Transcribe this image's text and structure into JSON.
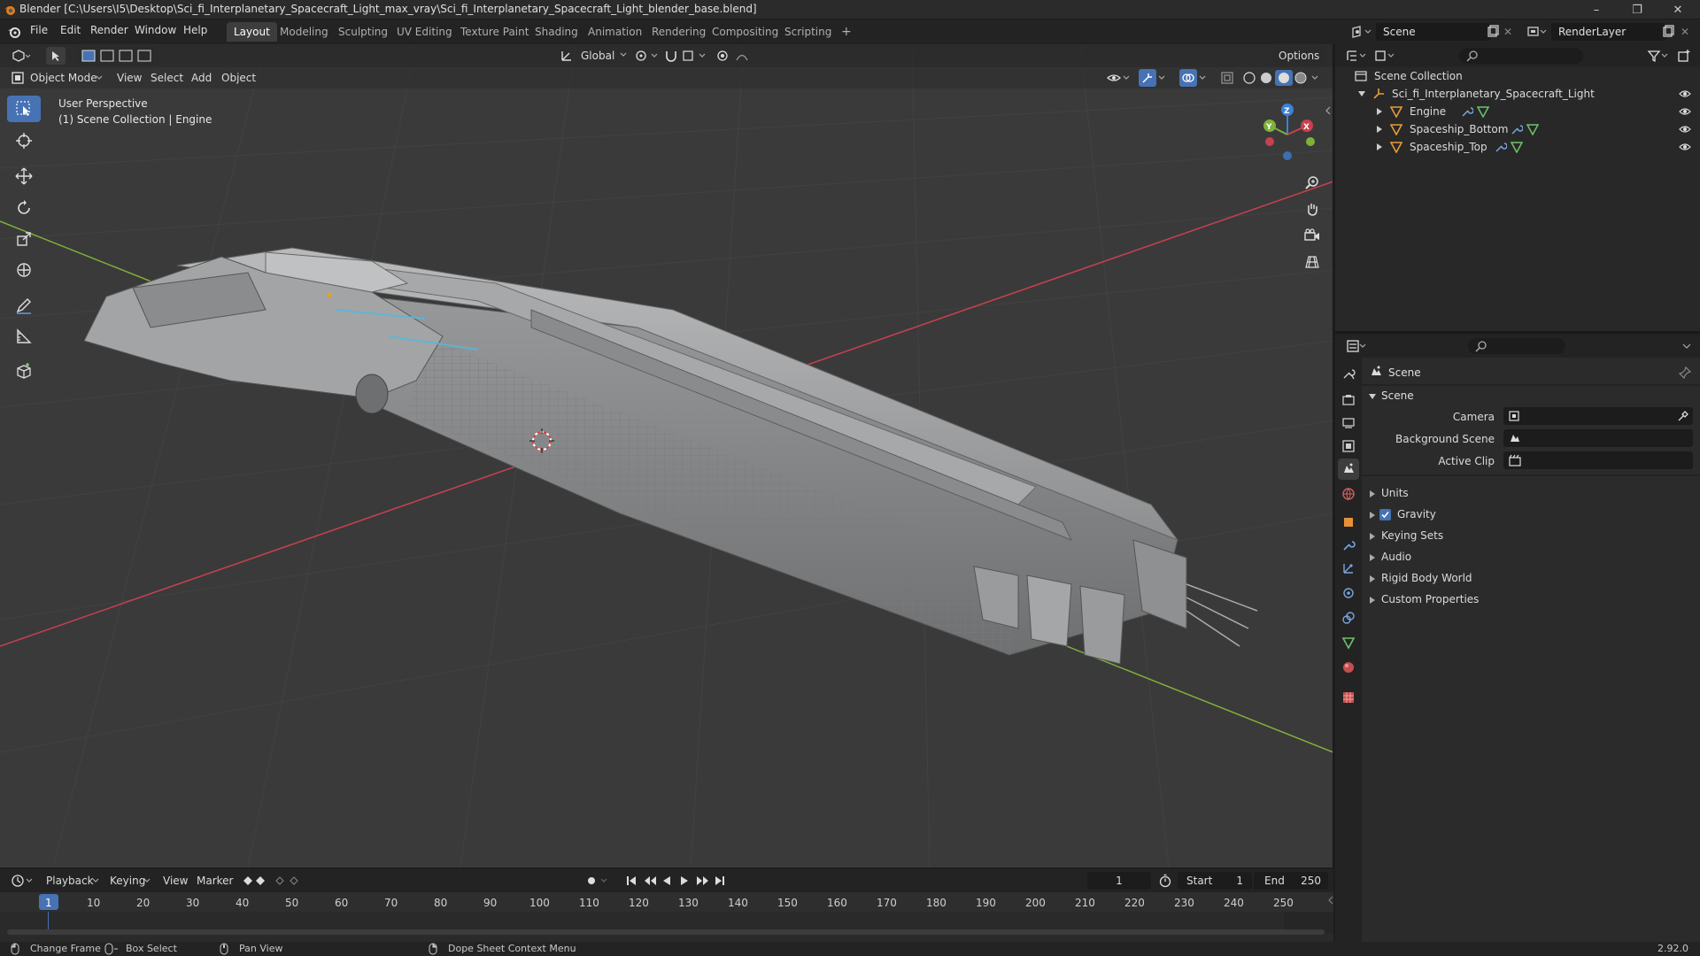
{
  "window": {
    "title": "Blender [C:\\Users\\I5\\Desktop\\Sci_fi_Interplanetary_Spacecraft_Light_max_vray\\Sci_fi_Interplanetary_Spacecraft_Light_blender_base.blend]",
    "minimize": "–",
    "maximize": "❐",
    "close": "✕"
  },
  "menu": [
    "File",
    "Edit",
    "Render",
    "Window",
    "Help"
  ],
  "workspaces": [
    "Layout",
    "Modeling",
    "Sculpting",
    "UV Editing",
    "Texture Paint",
    "Shading",
    "Animation",
    "Rendering",
    "Compositing",
    "Scripting"
  ],
  "add_workspace": "+",
  "scene_name": "Scene",
  "view_layer": "RenderLayer",
  "viewport": {
    "transform_orientation": "Global",
    "options_label": "Options",
    "mode": "Object Mode",
    "header_menus": [
      "View",
      "Select",
      "Add",
      "Object"
    ],
    "perspective_label": "User Perspective",
    "collection_label": "(1) Scene Collection | Engine",
    "gizmo": {
      "x": "X",
      "y": "Y",
      "z": "Z"
    }
  },
  "outliner": {
    "root": "Scene Collection",
    "collection": "Sci_fi_Interplanetary_Spacecraft_Light",
    "objects": [
      {
        "name": "Engine"
      },
      {
        "name": "Spaceship_Bottom"
      },
      {
        "name": "Spaceship_Top"
      }
    ]
  },
  "properties": {
    "context": "Scene",
    "panel": "Scene",
    "fields": [
      {
        "label": "Camera"
      },
      {
        "label": "Background Scene"
      },
      {
        "label": "Active Clip"
      }
    ],
    "subpanels": [
      "Units",
      "Gravity",
      "Keying Sets",
      "Audio",
      "Rigid Body World",
      "Custom Properties"
    ],
    "gravity_checked": true
  },
  "timeline": {
    "menus": [
      "Playback",
      "Keying",
      "View",
      "Marker"
    ],
    "current_frame": "1",
    "start_label": "Start",
    "start_value": "1",
    "end_label": "End",
    "end_value": "250",
    "ruler": [
      "1",
      "10",
      "20",
      "30",
      "40",
      "50",
      "60",
      "70",
      "80",
      "90",
      "100",
      "110",
      "120",
      "130",
      "140",
      "150",
      "160",
      "170",
      "180",
      "190",
      "200",
      "210",
      "220",
      "230",
      "240",
      "250"
    ]
  },
  "statusbar": {
    "change_frame": "Change Frame",
    "box_select": "Box Select",
    "pan_view": "Pan View",
    "context_menu": "Dope Sheet Context Menu",
    "version": "2.92.0"
  },
  "colors": {
    "accent": "#4772b3",
    "x_axis": "#c8414e",
    "y_axis": "#7fb13a",
    "z_axis": "#3b82d8",
    "grid": "#444444"
  }
}
